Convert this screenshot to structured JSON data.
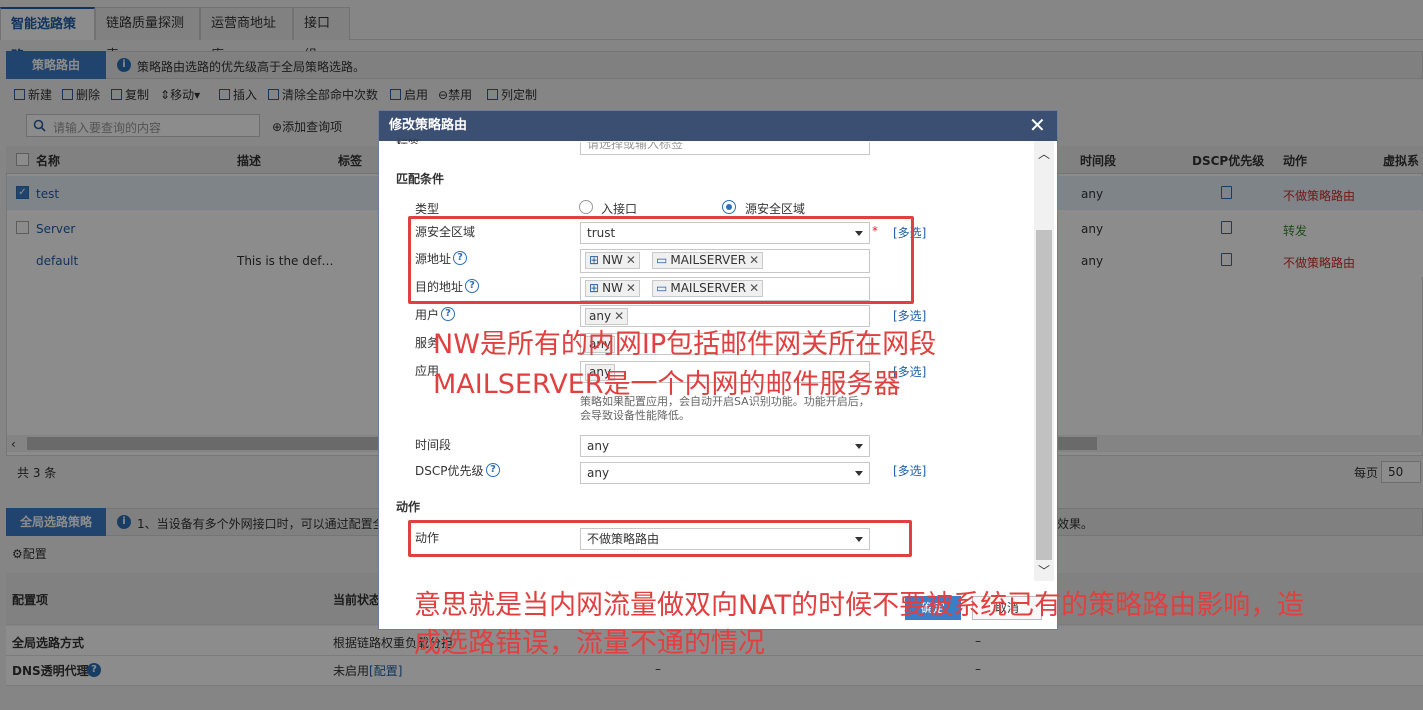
{
  "tabs": [
    "智能选路策略",
    "链路质量探测表",
    "运营商地址库",
    "接口组"
  ],
  "policy_section": {
    "title": "策略路由",
    "info": "策略路由选路的优先级高于全局策略选路。"
  },
  "toolbar": {
    "new": "新建",
    "delete": "删除",
    "copy": "复制",
    "move": "移动",
    "insert": "插入",
    "clear": "清除全部命中次数",
    "enable": "启用",
    "disable": "禁用",
    "columns": "列定制"
  },
  "search": {
    "placeholder": "请输入要查询的内容",
    "add_query": "添加查询项"
  },
  "table": {
    "headers": {
      "name": "名称",
      "desc": "描述",
      "tag": "标签",
      "time": "时间段",
      "dscp": "DSCP优先级",
      "action": "动作",
      "vsys": "虚拟系"
    },
    "rows": [
      {
        "name": "test",
        "desc": "",
        "time": "any",
        "action": "不做策略路由",
        "checked": true
      },
      {
        "name": "Server",
        "desc": "",
        "time": "any",
        "action": "转发",
        "checked": false
      },
      {
        "name": "default",
        "desc": "This is the def…",
        "time": "any",
        "action": "不做策略路由",
        "checked": false
      }
    ],
    "total": "共 3 条",
    "per_page_label": "每页",
    "per_page": "50"
  },
  "global_section": {
    "title": "全局选路策略",
    "info_left": "1、当设备有多个外网接口时，可以通过配置全",
    "info_right": "效果。",
    "config": "配置"
  },
  "bottom_table": {
    "headers": [
      "配置项",
      "当前状态"
    ],
    "rows": [
      {
        "item": "全局选路方式",
        "status": "根据链路权重负载分担",
        "dash1": "–"
      },
      {
        "item": "DNS透明代理",
        "status": "未启用",
        "link": "[配置]",
        "dash1": "–",
        "dash2": "–"
      }
    ]
  },
  "modal": {
    "title": "修改策略路由",
    "tag_label": "标签",
    "tag_placeholder": "请选择或输入标签",
    "match_section": "匹配条件",
    "type_label": "类型",
    "type_options": [
      "入接口",
      "源安全区域"
    ],
    "type_selected": 1,
    "src_zone_label": "源安全区域",
    "src_zone_value": "trust",
    "src_addr_label": "源地址",
    "src_addr_chips": [
      "NW",
      "MAILSERVER"
    ],
    "dst_addr_label": "目的地址",
    "dst_addr_chips": [
      "NW",
      "MAILSERVER"
    ],
    "user_label": "用户",
    "user_chip": "any",
    "service_label": "服务",
    "service_chip": "any",
    "app_label": "应用",
    "app_chip": "any",
    "app_hint": "策略如果配置应用，会自动开启SA识别功能。功能开启后，会导致设备性能降低。",
    "time_label": "时间段",
    "time_value": "any",
    "dscp_label": "DSCP优先级",
    "dscp_value": "any",
    "multi_select": "[多选]",
    "action_section": "动作",
    "action_label": "动作",
    "action_value": "不做策略路由",
    "ok": "确定",
    "cancel": "取消"
  },
  "annotations": {
    "line1": "NW是所有的内网IP包括邮件网关所在网段",
    "line2": "MAILSERVER是一个内网的邮件服务器",
    "line3": "意思就是当内网流量做双向NAT的时候不要被系统已有的策略路由影响，造",
    "line4": "成选路错误，流量不通的情况"
  },
  "colors": {
    "accent": "#3d7cc9",
    "modal_title": "#3b4f72",
    "annotation": "#e0403f",
    "danger": "#d42b2b",
    "success": "#3a8a2e"
  }
}
